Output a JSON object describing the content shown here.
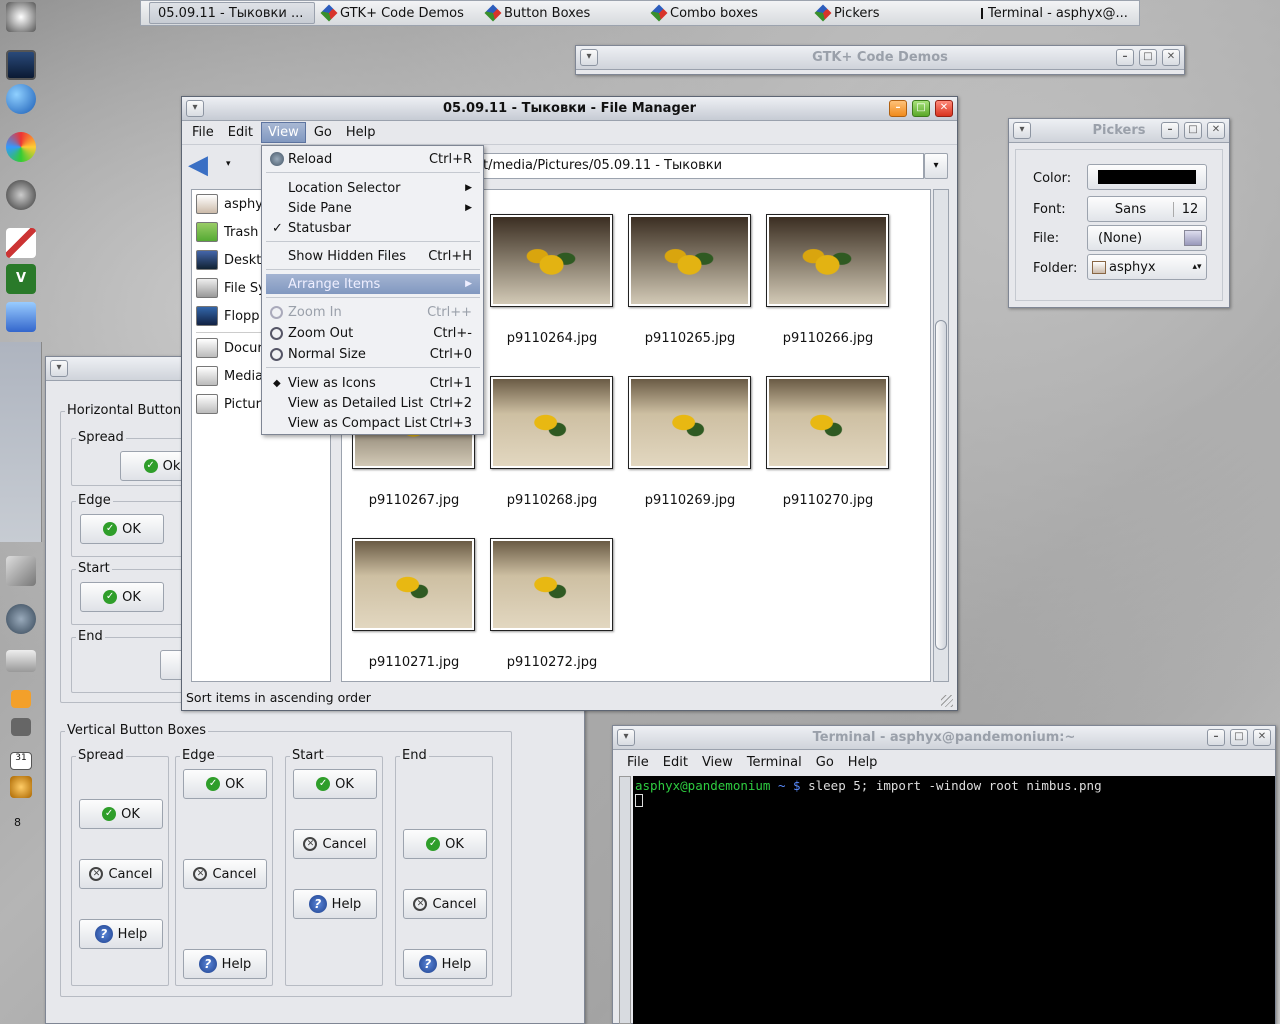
{
  "taskbar": {
    "tasks": [
      {
        "label": "05.09.11 - Тыковки ...",
        "active": true
      },
      {
        "label": "GTK+ Code Demos"
      },
      {
        "label": "Button Boxes"
      },
      {
        "label": "Combo boxes"
      },
      {
        "label": "Pickers"
      },
      {
        "label": "Terminal - asphyx@..."
      }
    ]
  },
  "gtk_demos": {
    "title": "GTK+ Code Demos"
  },
  "pickers": {
    "title": "Pickers",
    "color_label": "Color:",
    "color_value": "#000000",
    "font_label": "Font:",
    "font_name": "Sans",
    "font_size": "12",
    "file_label": "File:",
    "file_value": "(None)",
    "folder_label": "Folder:",
    "folder_value": "asphyx"
  },
  "filemanager": {
    "title": "05.09.11 - Тыковки - File Manager",
    "menus": [
      "File",
      "Edit",
      "View",
      "Go",
      "Help"
    ],
    "location": "t/media/Pictures/05.09.11 - Тыковки",
    "sidebar": [
      "asphy",
      "Trash",
      "Deskt",
      "File Sy",
      "Flopp",
      "Docur",
      "Media",
      "Pictur"
    ],
    "files": [
      "p9110264.jpg",
      "p9110265.jpg",
      "p9110266.jpg",
      "p9110267.jpg",
      "p9110268.jpg",
      "p9110269.jpg",
      "p9110270.jpg",
      "p9110271.jpg",
      "p9110272.jpg"
    ],
    "status": "Sort items in ascending order"
  },
  "view_menu": {
    "items": [
      {
        "label": "Reload",
        "accel": "Ctrl+R"
      },
      {
        "label": "Location Selector"
      },
      {
        "label": "Side Pane"
      },
      {
        "label": "Statusbar",
        "checked": true
      },
      {
        "label": "Show Hidden Files",
        "accel": "Ctrl+H"
      },
      {
        "label": "Arrange Items"
      },
      {
        "label": "Zoom In",
        "accel": "Ctrl++"
      },
      {
        "label": "Zoom Out",
        "accel": "Ctrl+-"
      },
      {
        "label": "Normal Size",
        "accel": "Ctrl+0"
      },
      {
        "label": "View as Icons",
        "accel": "Ctrl+1",
        "selected": true
      },
      {
        "label": "View as Detailed List",
        "accel": "Ctrl+2"
      },
      {
        "label": "View as Compact List",
        "accel": "Ctrl+3"
      }
    ]
  },
  "buttonboxes": {
    "horizontal": "Horizontal Button",
    "vertical": "Vertical Button Boxes",
    "groups": [
      "Spread",
      "Edge",
      "Start",
      "End"
    ],
    "ok": "OK",
    "ok_clip": "Ok",
    "cancel": "Cancel",
    "help": "Help"
  },
  "terminal": {
    "title": "Terminal - asphyx@pandemonium:~",
    "menus": [
      "File",
      "Edit",
      "View",
      "Terminal",
      "Go",
      "Help"
    ],
    "prompt_user": "asphyx@pandemonium",
    "prompt_path": "~ $",
    "command": "sleep 5; import -window root nimbus.png"
  },
  "dock": {
    "clock": "31",
    "tray": "8"
  }
}
